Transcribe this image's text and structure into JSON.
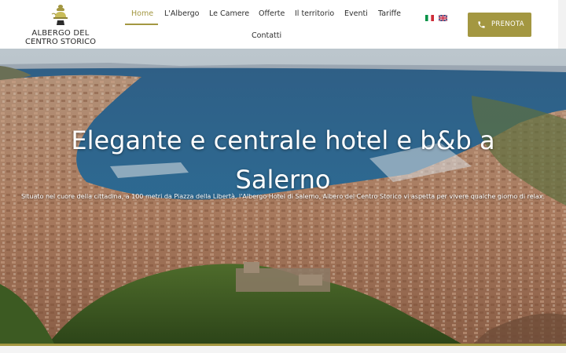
{
  "brand": {
    "line1": "ALBERGO DEL",
    "line2": "CENTRO STORICO",
    "accent_color": "#a39741"
  },
  "nav": {
    "items": [
      {
        "label": "Home",
        "active": true
      },
      {
        "label": "L'Albergo"
      },
      {
        "label": "Le Camere"
      },
      {
        "label": "Offerte"
      },
      {
        "label": "Il territorio"
      },
      {
        "label": "Eventi"
      },
      {
        "label": "Tariffe"
      },
      {
        "label": "Contatti"
      }
    ],
    "languages": [
      {
        "code": "it",
        "icon": "italian-flag-icon"
      },
      {
        "code": "en",
        "icon": "uk-flag-icon"
      }
    ],
    "book_button": {
      "label": "PRENOTA",
      "icon": "phone-icon"
    }
  },
  "hero": {
    "title": "Elegante e centrale hotel e b&b a Salerno",
    "subtitle": "Situato nel cuore della cittadina, a 100 metri da Piazza della Libertà, l'Albergo Hotel di Salerno, Albero del Centro Storico vi aspetta per vivere qualche giorno di relax.",
    "image": "aerial-city-coast-photo"
  }
}
